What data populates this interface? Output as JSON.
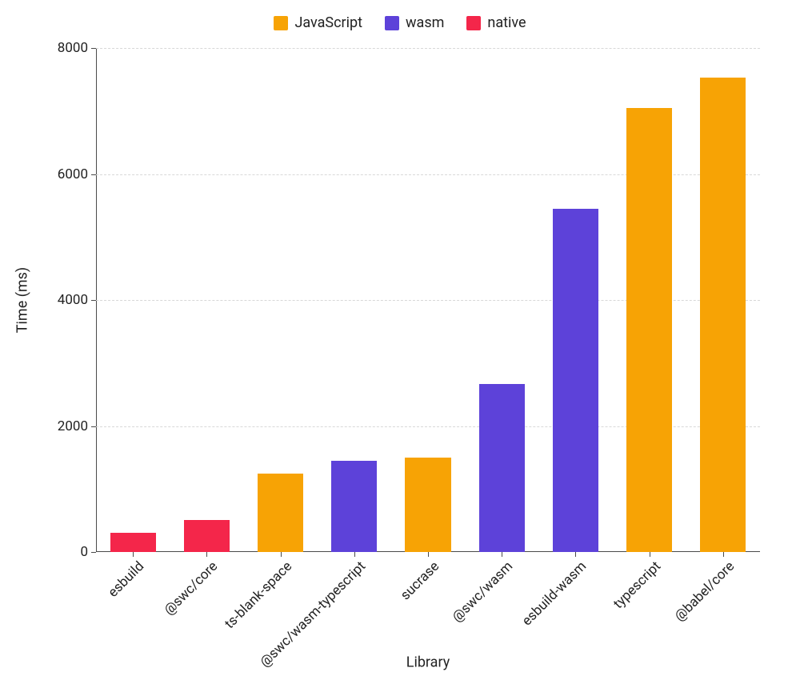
{
  "chart_data": {
    "type": "bar",
    "title": "",
    "xlabel": "Library",
    "ylabel": "Time (ms)",
    "ylim": [
      0,
      8000
    ],
    "yticks": [
      0,
      2000,
      4000,
      6000,
      8000
    ],
    "legend_position": "top",
    "legend": [
      {
        "name": "JavaScript",
        "color": "#f7a305"
      },
      {
        "name": "wasm",
        "color": "#5d42d9"
      },
      {
        "name": "native",
        "color": "#f4264a"
      }
    ],
    "categories": [
      "esbuild",
      "@swc/core",
      "ts-blank-space",
      "@swc/wasm-typescript",
      "sucrase",
      "@swc/wasm",
      "esbuild-wasm",
      "typescript",
      "@babel/core"
    ],
    "bars": [
      {
        "label": "esbuild",
        "value": 300,
        "series": "native",
        "color": "#f4264a"
      },
      {
        "label": "@swc/core",
        "value": 510,
        "series": "native",
        "color": "#f4264a"
      },
      {
        "label": "ts-blank-space",
        "value": 1250,
        "series": "JavaScript",
        "color": "#f7a305"
      },
      {
        "label": "@swc/wasm-typescript",
        "value": 1450,
        "series": "wasm",
        "color": "#5d42d9"
      },
      {
        "label": "sucrase",
        "value": 1500,
        "series": "JavaScript",
        "color": "#f7a305"
      },
      {
        "label": "@swc/wasm",
        "value": 2670,
        "series": "wasm",
        "color": "#5d42d9"
      },
      {
        "label": "esbuild-wasm",
        "value": 5450,
        "series": "wasm",
        "color": "#5d42d9"
      },
      {
        "label": "typescript",
        "value": 7050,
        "series": "JavaScript",
        "color": "#f7a305"
      },
      {
        "label": "@babel/core",
        "value": 7530,
        "series": "JavaScript",
        "color": "#f7a305"
      }
    ]
  }
}
